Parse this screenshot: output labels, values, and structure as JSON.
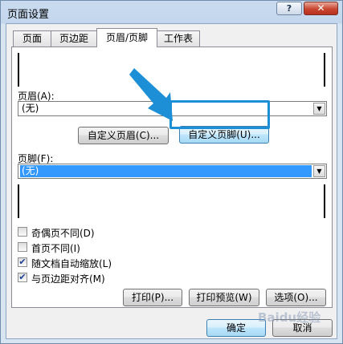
{
  "window": {
    "title": "页面设置",
    "help": "?",
    "close": "✕"
  },
  "tabs": [
    "页面",
    "页边距",
    "页眉/页脚",
    "工作表"
  ],
  "header": {
    "label": "页眉(A):",
    "value": "(无)"
  },
  "buttons": {
    "custom_header": "自定义页眉(C)...",
    "custom_footer": "自定义页脚(U)..."
  },
  "footer": {
    "label": "页脚(F):",
    "value": "(无)"
  },
  "options": [
    {
      "label": "奇偶页不同(D)",
      "checked": false
    },
    {
      "label": "首页不同(I)",
      "checked": false
    },
    {
      "label": "随文档自动缩放(L)",
      "checked": true
    },
    {
      "label": "与页边距对齐(M)",
      "checked": true
    }
  ],
  "actions": {
    "print": "打印(P)...",
    "preview": "打印预览(W)",
    "options": "选项(O)..."
  },
  "dialog": {
    "ok": "确定",
    "cancel": "取消"
  },
  "annotation": {
    "arrow_color": "#1c8fd6",
    "highlight_color": "#1c8fd6"
  },
  "watermark": "Baidu经验",
  "colors": {
    "selection": "#3399ff",
    "title_bg": "#c3d6ec",
    "close_button": "#c8452f"
  }
}
